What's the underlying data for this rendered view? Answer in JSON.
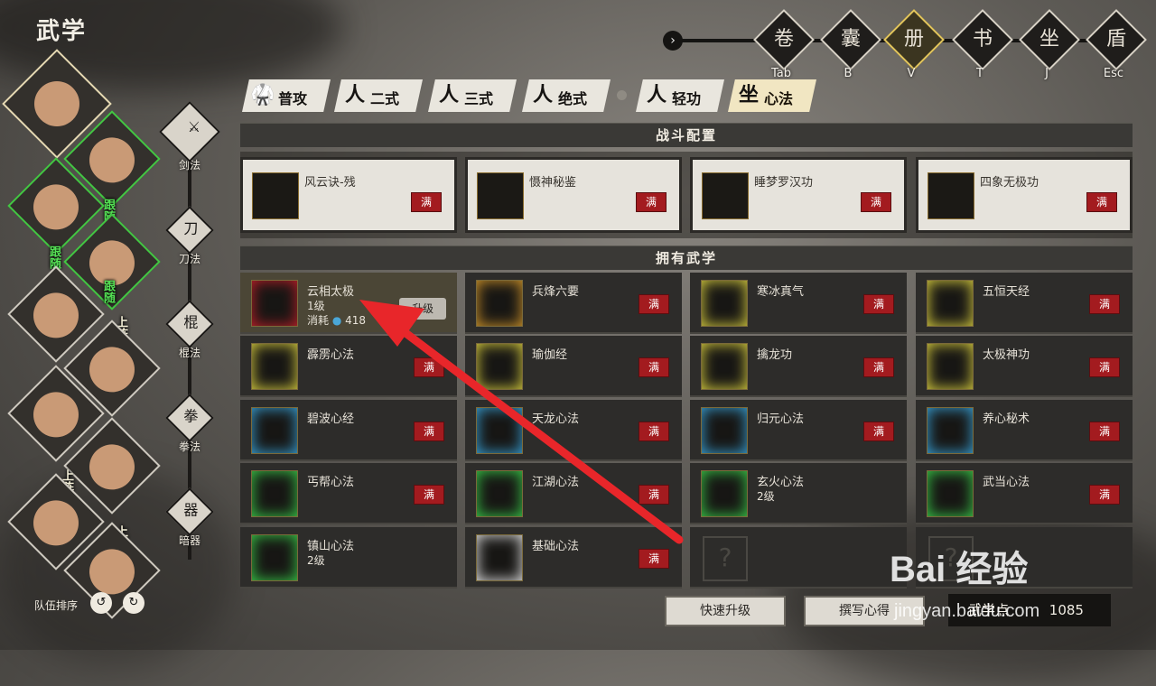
{
  "screen_title": "武学",
  "hotkeys": [
    {
      "key": "Tab",
      "icon": "map-scroll-icon"
    },
    {
      "key": "B",
      "icon": "inventory-icon"
    },
    {
      "key": "V",
      "icon": "martial-book-icon",
      "active": true
    },
    {
      "key": "T",
      "icon": "quest-scroll-icon"
    },
    {
      "key": "J",
      "icon": "meditation-icon"
    },
    {
      "key": "Esc",
      "icon": "settings-shield-icon"
    }
  ],
  "tabs": [
    {
      "label": "普攻",
      "icon": "basic-attack-icon"
    },
    {
      "label": "二式",
      "icon": "second-form-icon"
    },
    {
      "label": "三式",
      "icon": "third-form-icon"
    },
    {
      "label": "绝式",
      "icon": "ultimate-form-icon"
    },
    {
      "label": "轻功",
      "icon": "lightfoot-icon"
    },
    {
      "label": "心法",
      "icon": "inner-art-icon",
      "active": true
    }
  ],
  "sections": {
    "combat_config": "战斗配置",
    "owned": "拥有武学"
  },
  "equipped": [
    {
      "name": "风云诀-残",
      "badge": "满"
    },
    {
      "name": "慑神秘鉴",
      "badge": "满"
    },
    {
      "name": "睡梦罗汉功",
      "badge": "满"
    },
    {
      "name": "四象无极功",
      "badge": "满"
    }
  ],
  "owned": [
    {
      "name": "云相太极",
      "level": "1级",
      "cost_label": "消耗",
      "cost_value": "418",
      "upgrade": "升级",
      "selected": true,
      "color": "#c8202a"
    },
    {
      "name": "兵烽六要",
      "badge": "满",
      "color": "#d89a2a"
    },
    {
      "name": "寒冰真气",
      "badge": "满",
      "color": "#e0d640"
    },
    {
      "name": "五恒天经",
      "badge": "满",
      "color": "#e0d640"
    },
    {
      "name": "霹雳心法",
      "badge": "满",
      "color": "#e0d640"
    },
    {
      "name": "瑜伽经",
      "badge": "满",
      "color": "#e0d640"
    },
    {
      "name": "擒龙功",
      "badge": "满",
      "color": "#e0d640"
    },
    {
      "name": "太极神功",
      "badge": "满",
      "color": "#e0d640"
    },
    {
      "name": "碧波心经",
      "badge": "满",
      "color": "#3aa8e0"
    },
    {
      "name": "天龙心法",
      "badge": "满",
      "color": "#3aa8e0"
    },
    {
      "name": "归元心法",
      "badge": "满",
      "color": "#3aa8e0"
    },
    {
      "name": "养心秘术",
      "badge": "满",
      "color": "#3aa8e0"
    },
    {
      "name": "丐帮心法",
      "badge": "满",
      "color": "#3ad04a"
    },
    {
      "name": "江湖心法",
      "badge": "满",
      "color": "#3ad04a"
    },
    {
      "name": "玄火心法",
      "level": "2级",
      "color": "#3ad04a"
    },
    {
      "name": "武当心法",
      "badge": "满",
      "color": "#3ad04a"
    },
    {
      "name": "镇山心法",
      "level": "2级",
      "color": "#3ad04a"
    },
    {
      "name": "基础心法",
      "badge": "满",
      "color": "#e8e8e8"
    },
    {
      "empty": true,
      "placeholder": "?"
    },
    {
      "empty": true,
      "placeholder": "?"
    }
  ],
  "buttons": {
    "quick_upgrade": "快速升级",
    "write": "撰写心得",
    "wuxue_label": "武学点",
    "wuxue_value": "1085"
  },
  "party_tags": {
    "follow": "跟随",
    "onfield": "上阵"
  },
  "weapon_categories": [
    "剑法",
    "刀法",
    "棍法",
    "拳法",
    "暗器"
  ],
  "team_sort": "队伍排序",
  "watermark": {
    "brand": "Bai 经验",
    "url": "jingyan.baidu.com"
  }
}
